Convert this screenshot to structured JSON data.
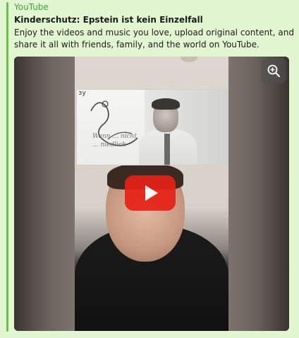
{
  "link_preview": {
    "source": "YouTube",
    "title": "Kinderschutz: Epstein ist kein Einzelfall",
    "description": "Enjoy the videos and music you love, upload original content, and share it all with friends, family, and the world on YouTube."
  },
  "media": {
    "zoom_icon": "zoom-in-icon",
    "play_icon": "youtube-play-icon",
    "inset": {
      "corner_label": "зу",
      "handwriting": "Wenn ... nicht ... niedlich"
    }
  },
  "colors": {
    "accent": "#6cc04a",
    "source_text": "#3fa436",
    "card_bg": "#e3f6d2",
    "play_button": "#e62117"
  }
}
